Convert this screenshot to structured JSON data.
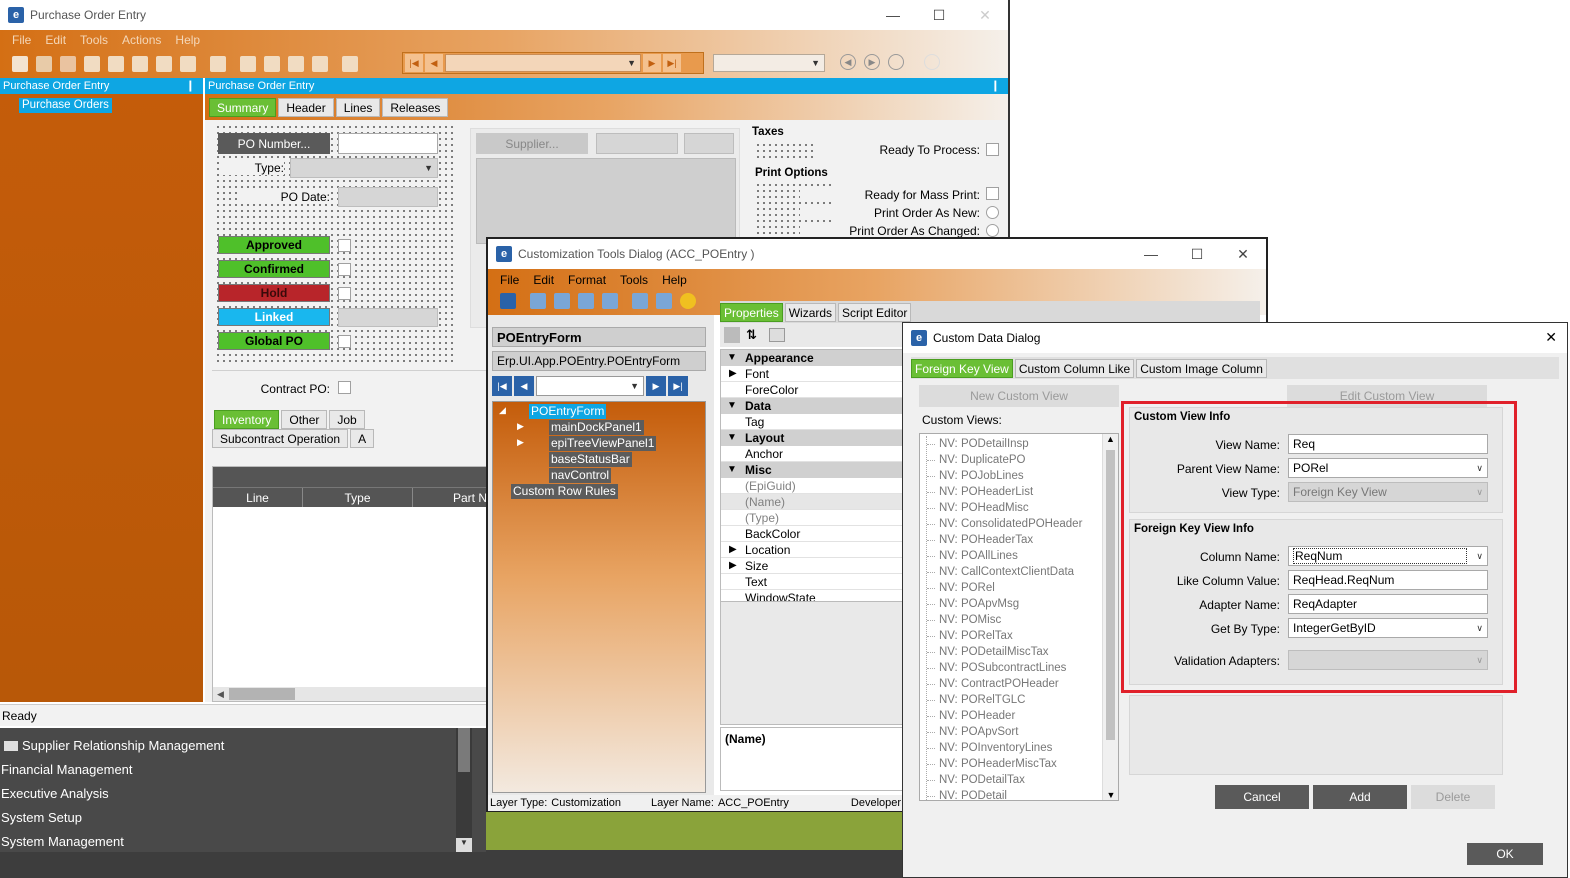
{
  "po_window": {
    "title": "Purchase Order Entry",
    "menu": [
      "File",
      "Edit",
      "Tools",
      "Actions",
      "Help"
    ],
    "left_panel_title": "Purchase Order Entry",
    "tree_item": "Purchase Orders",
    "main_panel_title": "Purchase Order Entry",
    "tabs": [
      "Summary",
      "Header",
      "Lines",
      "Releases"
    ],
    "po_number_btn": "PO Number...",
    "type_label": "Type:",
    "po_date_label": "PO Date:",
    "supplier_btn": "Supplier...",
    "status_badges": [
      {
        "label": "Approved",
        "color": "#4fc02a"
      },
      {
        "label": "Confirmed",
        "color": "#4fc02a"
      },
      {
        "label": "Hold",
        "color": "#b8252a"
      },
      {
        "label": "Linked",
        "color": "#19b7ee"
      },
      {
        "label": "Global PO",
        "color": "#4fc02a"
      }
    ],
    "contract_po_label": "Contract PO:",
    "taxes_title": "Taxes",
    "ready_to_process": "Ready To Process:",
    "print_options_title": "Print Options",
    "ready_mass_print": "Ready for Mass Print:",
    "print_order_new": "Print Order As New:",
    "print_order_changed": "Print Order As Changed:",
    "subtabs": [
      "Inventory",
      "Other",
      "Job",
      "Subcontract Operation",
      "A"
    ],
    "grid_headers": [
      "Line",
      "Type",
      "Part N"
    ],
    "status_text": "Ready"
  },
  "nav_panel": {
    "items": [
      "Supplier Relationship Management",
      "Financial Management",
      "Executive Analysis",
      "System Setup",
      "System Management"
    ]
  },
  "ct_dialog": {
    "title": "Customization Tools Dialog  (ACC_POEntry )",
    "menu": [
      "File",
      "Edit",
      "Format",
      "Tools",
      "Help"
    ],
    "form_name": "POEntryForm",
    "form_class": "Erp.UI.App.POEntry.POEntryForm",
    "tabs": [
      "Properties",
      "Wizards",
      "Script Editor"
    ],
    "tree": [
      "POEntryForm",
      "mainDockPanel1",
      "epiTreeViewPanel1",
      "baseStatusBar",
      "navControl",
      "Custom Row Rules"
    ],
    "properties": {
      "appearance": "Appearance",
      "font": "Font",
      "forecolor": "ForeColor",
      "data": "Data",
      "tag": "Tag",
      "layout": "Layout",
      "anchor": "Anchor",
      "misc": "Misc",
      "epiguid": "(EpiGuid)",
      "name": "(Name)",
      "type": "(Type)",
      "backcolor": "BackColor",
      "location": "Location",
      "size": "Size",
      "text": "Text",
      "windowstate": "WindowState"
    },
    "desc_title": "(Name)",
    "status": {
      "layer_type_label": "Layer Type:",
      "layer_type": "Customization",
      "layer_name_label": "Layer Name:",
      "layer_name": "ACC_POEntry",
      "developer": "Developer Li"
    }
  },
  "cd_dialog": {
    "title": "Custom Data Dialog",
    "close_glyph": "✕",
    "tabs": [
      "Foreign Key View",
      "Custom Column Like",
      "Custom Image Column"
    ],
    "new_view_btn": "New Custom View",
    "edit_view_btn": "Edit Custom View",
    "custom_views_label": "Custom Views:",
    "views": [
      "NV: PODetailInsp",
      "NV: DuplicatePO",
      "NV: POJobLines",
      "NV: POHeaderList",
      "NV: POHeadMisc",
      "NV: ConsolidatedPOHeader",
      "NV: POHeaderTax",
      "NV: POAllLines",
      "NV: CallContextClientData",
      "NV: PORel",
      "NV: POApvMsg",
      "NV: POMisc",
      "NV: PORelTax",
      "NV: PODetailMiscTax",
      "NV: POSubcontractLines",
      "NV: ContractPOHeader",
      "NV: PORelTGLC",
      "NV: POHeader",
      "NV: POApvSort",
      "NV: POInventoryLines",
      "NV: POHeaderMiscTax",
      "NV: PODetailTax",
      "NV: PODetail"
    ],
    "custom_view_info": "Custom View Info",
    "view_name_label": "View Name:",
    "view_name": "Req",
    "parent_view_label": "Parent View Name:",
    "parent_view": "PORel",
    "view_type_label": "View Type:",
    "view_type": "Foreign Key View",
    "fk_info": "Foreign Key View Info",
    "column_name_label": "Column Name:",
    "column_name": "ReqNum",
    "like_column_label": "Like Column Value:",
    "like_column": "ReqHead.ReqNum",
    "adapter_label": "Adapter Name:",
    "adapter": "ReqAdapter",
    "get_by_label": "Get By Type:",
    "get_by": "IntegerGetByID",
    "validation_label": "Validation Adapters:",
    "cancel_btn": "Cancel",
    "add_btn": "Add",
    "delete_btn": "Delete",
    "ok_btn": "OK",
    "highlight_color": "#e0202a"
  }
}
